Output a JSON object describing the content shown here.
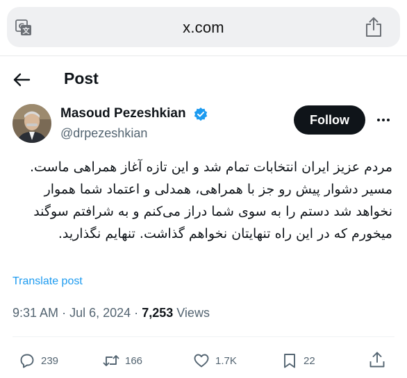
{
  "browser": {
    "url": "x.com",
    "translate_icon": "translate-icon",
    "share_icon": "share-icon"
  },
  "header": {
    "title": "Post",
    "back_icon": "back-arrow-icon"
  },
  "author": {
    "name": "Masoud Pezeshkian",
    "handle": "@drpezeshkian",
    "verified": true,
    "follow_label": "Follow"
  },
  "post": {
    "text": "مردم عزیز ایران انتخابات تمام شد و این تازه آغاز همراهی ماست. مسیر دشوار پیش رو جز با همراهی، همدلی و اعتماد شما هموار نخواهد شد دستم را به سوی شما دراز می‌کنم و به شرافتم سوگند میخورم که در این راه تنهایتان نخواهم گذاشت. تنهایم نگذارید.",
    "translate_label": "Translate post",
    "time": "9:31 AM",
    "date": "Jul 6, 2024",
    "separator": "·",
    "views": "7,253",
    "views_label": "Views"
  },
  "actions": {
    "replies": "239",
    "reposts": "166",
    "likes": "1.7K",
    "bookmarks": "22"
  },
  "colors": {
    "accent": "#1d9bf0",
    "text": "#0f1419",
    "muted": "#536471",
    "follow_bg": "#0f1419",
    "address_bar": "#eff0f2"
  }
}
